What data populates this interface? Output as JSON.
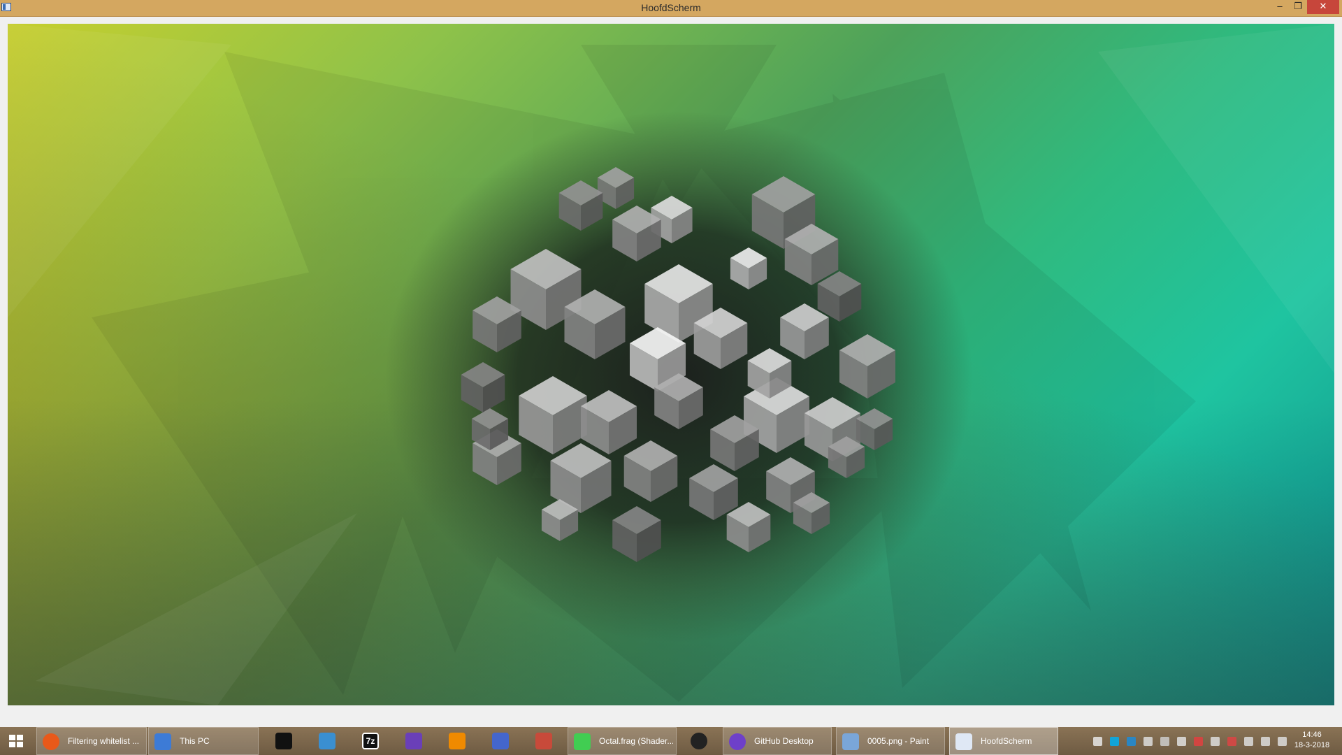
{
  "window": {
    "title": "HoofdScherm",
    "controls": {
      "minimize": "–",
      "maximize": "❐",
      "close": "✕"
    }
  },
  "taskbar": {
    "start_icon": "windows-logo-icon",
    "items": [
      {
        "label": "Filtering whitelist ...",
        "icon": "firefox-icon",
        "color": "#e8591a",
        "kind": "task"
      },
      {
        "label": "This PC",
        "icon": "computer-icon",
        "color": "#3d7bd6",
        "kind": "task"
      },
      {
        "label": "",
        "icon": "panda-app-icon",
        "color": "#111111",
        "kind": "pinned"
      },
      {
        "label": "",
        "icon": "duck-app-icon",
        "color": "#3a8fd1",
        "kind": "pinned"
      },
      {
        "label": "7z",
        "icon": "7zip-icon",
        "color": "#111111",
        "kind": "pinned"
      },
      {
        "label": "",
        "icon": "gear-icon",
        "color": "#6a3fb8",
        "kind": "pinned"
      },
      {
        "label": "",
        "icon": "vlc-icon",
        "color": "#f08a00",
        "kind": "pinned"
      },
      {
        "label": "",
        "icon": "bird-app-icon",
        "color": "#4466cc",
        "kind": "pinned"
      },
      {
        "label": "",
        "icon": "tool-app-icon",
        "color": "#c84a3a",
        "kind": "pinned"
      },
      {
        "label": "Octal.frag (Shader...",
        "icon": "qt-icon",
        "color": "#41cd52",
        "kind": "task"
      },
      {
        "label": "",
        "icon": "camera-app-icon",
        "color": "#222222",
        "kind": "pinned"
      },
      {
        "label": "GitHub Desktop",
        "icon": "github-desktop-icon",
        "color": "#6e40c9",
        "kind": "task"
      },
      {
        "label": "0005.png - Paint",
        "icon": "paint-icon",
        "color": "#7aa6d8",
        "kind": "task"
      },
      {
        "label": "HoofdScherm",
        "icon": "app-window-icon",
        "color": "#dfe8f5",
        "kind": "active"
      }
    ],
    "tray_icons": [
      "chrome-tray-icon",
      "skype-tray-icon",
      "bluetooth-tray-icon",
      "network-tool-tray-icon",
      "display-tray-icon",
      "steam-tray-icon",
      "security-tray-icon",
      "volume-tray-icon",
      "flag-tray-icon",
      "battery-tray-icon",
      "signal-tray-icon",
      "speaker-tray-icon"
    ],
    "clock": {
      "time": "14:46",
      "date": "18-3-2018"
    }
  },
  "render": {
    "background_colors": [
      "#c6cf2e",
      "#4da25a",
      "#1fc4a0",
      "#0e8c8c"
    ],
    "object": "shaded cluster of grey cubes on dark halo"
  }
}
